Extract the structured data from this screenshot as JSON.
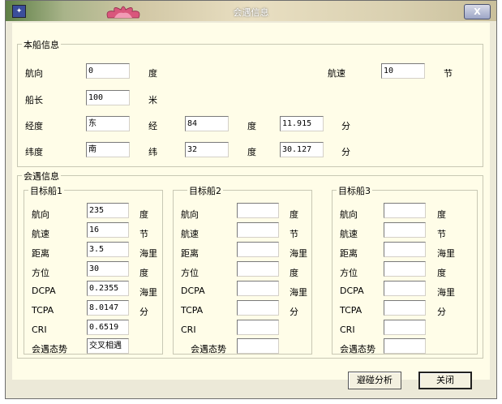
{
  "window": {
    "title": "会遇信息",
    "close_label": "X"
  },
  "own_ship": {
    "group_title": "本船信息",
    "heading": {
      "label": "航向",
      "value": "0",
      "unit": "度"
    },
    "speed": {
      "label": "航速",
      "value": "10",
      "unit": "节"
    },
    "length": {
      "label": "船长",
      "value": "100",
      "unit": "米"
    },
    "longitude": {
      "label": "经度",
      "hemi": "东",
      "word": "经",
      "deg": "84",
      "deg_unit": "度",
      "min": "11.915",
      "min_unit": "分"
    },
    "latitude": {
      "label": "纬度",
      "hemi": "南",
      "word": "纬",
      "deg": "32",
      "deg_unit": "度",
      "min": "30.127",
      "min_unit": "分"
    }
  },
  "encounter": {
    "group_title": "会遇信息",
    "labels": {
      "heading": "航向",
      "speed": "航速",
      "distance": "距离",
      "bearing": "方位",
      "dcpa": "DCPA",
      "tcpa": "TCPA",
      "cri": "CRI",
      "situation": "会遇态势"
    },
    "units": {
      "heading": "度",
      "speed": "节",
      "distance": "海里",
      "bearing": "度",
      "dcpa": "海里",
      "tcpa": "分"
    },
    "targets": [
      {
        "title": "目标船1",
        "heading": "235",
        "speed": "16",
        "distance": "3.5",
        "bearing": "30",
        "dcpa": "0.2355",
        "tcpa": "8.0147",
        "cri": "0.6519",
        "situation": "交叉相遇"
      },
      {
        "title": "目标船2",
        "heading": "",
        "speed": "",
        "distance": "",
        "bearing": "",
        "dcpa": "",
        "tcpa": "",
        "cri": "",
        "situation": ""
      },
      {
        "title": "目标船3",
        "heading": "",
        "speed": "",
        "distance": "",
        "bearing": "",
        "dcpa": "",
        "tcpa": "",
        "cri": "",
        "situation": ""
      }
    ]
  },
  "buttons": {
    "analyze": "避碰分析",
    "close": "关闭"
  }
}
